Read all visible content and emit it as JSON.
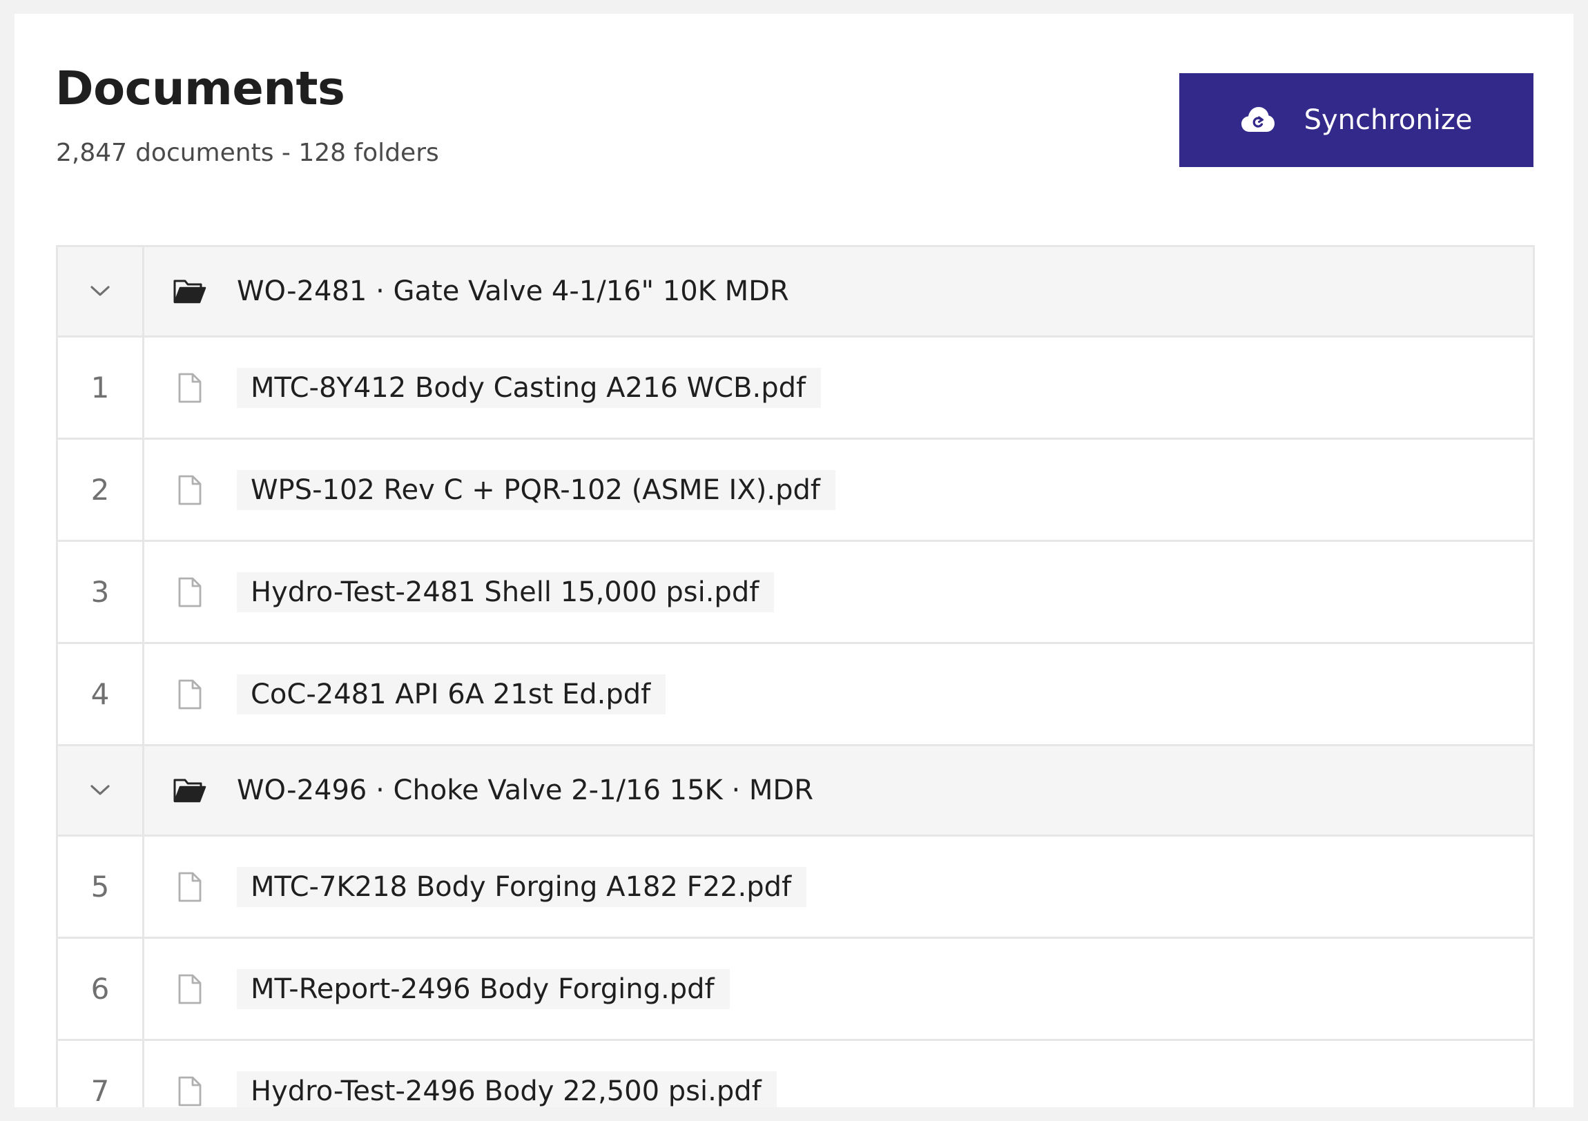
{
  "header": {
    "title": "Documents",
    "document_count": "2,847",
    "counts_rest": "documents - 128 folders",
    "sync_label": "Synchronize",
    "sync_icon": "cloud-sync-icon",
    "accent_color": "#33298a"
  },
  "table": {
    "rows": [
      {
        "type": "folder",
        "name": "WO-2481 · Gate Valve 4-1/16\" 10K  MDR",
        "toggle_icon": "chevron-down-icon",
        "icon": "folder-open-icon"
      },
      {
        "type": "file",
        "index": "1",
        "name": "MTC-8Y412 Body Casting A216 WCB.pdf",
        "icon": "file-icon"
      },
      {
        "type": "file",
        "index": "2",
        "name": "WPS-102 Rev C + PQR-102 (ASME IX).pdf",
        "icon": "file-icon"
      },
      {
        "type": "file",
        "index": "3",
        "name": "Hydro-Test-2481 Shell 15,000 psi.pdf",
        "icon": "file-icon"
      },
      {
        "type": "file",
        "index": "4",
        "name": "CoC-2481 API 6A 21st Ed.pdf",
        "icon": "file-icon"
      },
      {
        "type": "folder",
        "name": "WO-2496 · Choke Valve 2-1/16 15K · MDR",
        "toggle_icon": "chevron-down-icon",
        "icon": "folder-open-icon"
      },
      {
        "type": "file",
        "index": "5",
        "name": "MTC-7K218 Body Forging A182 F22.pdf",
        "icon": "file-icon"
      },
      {
        "type": "file",
        "index": "6",
        "name": "MT-Report-2496 Body Forging.pdf",
        "icon": "file-icon"
      },
      {
        "type": "file",
        "index": "7",
        "name": "Hydro-Test-2496 Body 22,500 psi.pdf",
        "icon": "file-icon"
      }
    ]
  }
}
